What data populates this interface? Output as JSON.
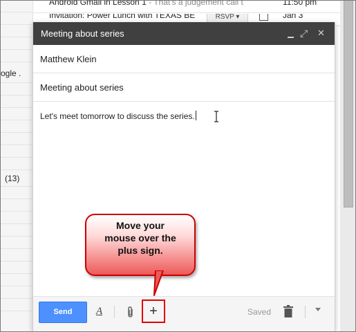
{
  "inbox": {
    "rows": [
      {
        "sender": "Android Gmail in Lesson 1",
        "snippet": " - That's a judgement call t",
        "time": "11:50 pm"
      },
      {
        "sender": "Invitation: Power Lunch with TEXAS BE",
        "snippet": "",
        "rsvp": "RSVP ▾",
        "time": "Jan 3"
      }
    ],
    "left_snippets": [
      "ogle .",
      "(13)"
    ]
  },
  "compose": {
    "title": "Meeting about series",
    "controls": {
      "popout": "⤢",
      "close": "✕"
    },
    "to": "Matthew Klein",
    "subject": "Meeting about series",
    "body": "Let's meet tomorrow to discuss the series.",
    "toolbar": {
      "send_label": "Send",
      "format_label": "A",
      "plus_label": "+",
      "saved_label": "Saved"
    }
  },
  "callout": {
    "text": "Move your\nmouse over the\nplus sign.",
    "border_color": "#cc0000"
  },
  "colors": {
    "header_bg": "#404040",
    "send_blue": "#4d90fe",
    "highlight_red": "#e00000"
  }
}
